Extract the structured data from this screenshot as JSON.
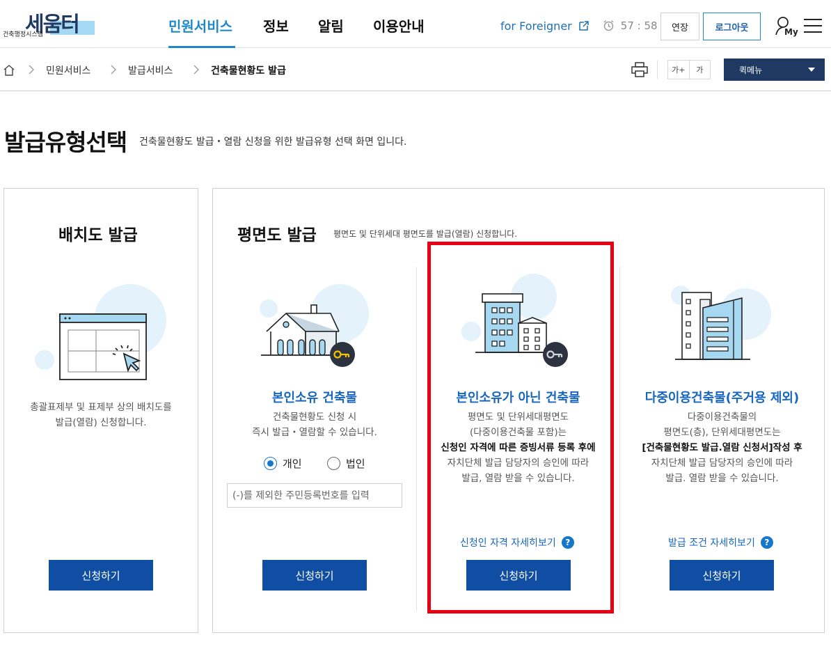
{
  "header": {
    "logo_text": "세움터",
    "logo_sub": "건축행정시스템",
    "nav": [
      {
        "label": "민원서비스",
        "active": true
      },
      {
        "label": "정보"
      },
      {
        "label": "알림"
      },
      {
        "label": "이용안내"
      }
    ],
    "foreigner_link": "for Foreigner",
    "timer": "57 : 58",
    "extend_label": "연장",
    "logout_label": "로그아웃",
    "my_label": "My"
  },
  "breadcrumb": {
    "items": [
      "민원서비스",
      "발급서비스",
      "건축물현황도 발급"
    ],
    "font_increase": "가+",
    "font_decrease": "가",
    "quick_menu": "퀵메뉴"
  },
  "page": {
    "title": "발급유형선택",
    "description": "건축물현황도 발급・열람 신청을 위한 발급유형 선택 화면 입니다."
  },
  "site_plan": {
    "title": "배치도 발급",
    "text_lines": [
      "총괄표제부 및 표제부 상의 배치도를",
      "발급(열람) 신청합니다."
    ],
    "button": "신청하기"
  },
  "floor_plan": {
    "title": "평면도 발급",
    "description": "평면도 및 단위세대 평면도를 발급(열람) 신청합니다.",
    "cards": [
      {
        "title": "본인소유 건축물",
        "text_lines": [
          "건축물현황도 신청 시",
          "즉시 발급・열람할 수 있습니다."
        ],
        "radio_options": [
          "개인",
          "법인"
        ],
        "selected_radio": "개인",
        "input_placeholder": "(-)를 제외한 주민등록번호를 입력",
        "input_value": "",
        "button": "신청하기"
      },
      {
        "title": "본인소유가 아닌 건축물",
        "text_lines": [
          "평면도 및 단위세대평면도",
          "(다중이용건축물 포함)는",
          "신청인 자격에 따른 증빙서류 등록 후에",
          "자치단체 발급 담당자의 승인에 따라",
          "발급, 열람 받을 수 있습니다."
        ],
        "link": "신청인 자격 자세히보기",
        "button": "신청하기"
      },
      {
        "title": "다중이용건축물(주거용 제외)",
        "text_lines": [
          "다중이용건축물의",
          "평면도(층), 단위세대평면도는",
          "[건축물현황도 발급.열람 신청서]작성 후",
          "자치단체 발급 담당자의 승인에 따라",
          "발급. 열람 받을 수 있습니다."
        ],
        "link": "발급 조건 자세히보기",
        "button": "신청하기"
      }
    ]
  },
  "colors": {
    "primary_button": "#0f4ea3",
    "accent_blue": "#1f8ac9",
    "card_title_blue": "#1666c0",
    "quick_menu_bg": "#1e3a63",
    "highlight_red": "#e60012"
  },
  "qmark_symbol": "?"
}
